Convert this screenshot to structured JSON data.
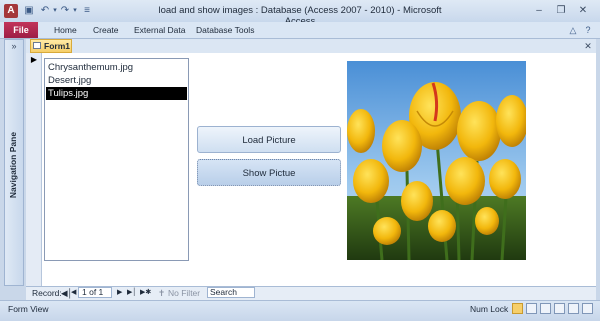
{
  "window": {
    "title": "load and show images : Database (Access 2007 - 2010)  -  Microsoft Access",
    "app_icon": "A"
  },
  "ribbon": {
    "file_tab": "File",
    "tabs": [
      "Home",
      "Create",
      "External Data",
      "Database Tools"
    ]
  },
  "nav_pane": {
    "label": "Navigation Pane",
    "toggle": "»"
  },
  "document": {
    "tab_label": "Form1"
  },
  "form": {
    "list_items": [
      "Chrysanthemum.jpg",
      "Desert.jpg",
      "Tulips.jpg"
    ],
    "selected_item": "Tulips.jpg",
    "load_button": "Load Picture",
    "show_button": "Show Pictue"
  },
  "record_nav": {
    "label": "Record:",
    "current": "1 of 1",
    "filter": "No Filter",
    "search_placeholder": "Search"
  },
  "status": {
    "left": "Form View",
    "num_lock": "Num Lock"
  },
  "colors": {
    "file_tab": "#a62a4f",
    "selection": "#000000",
    "accent_tab": "#f6cf6a"
  }
}
